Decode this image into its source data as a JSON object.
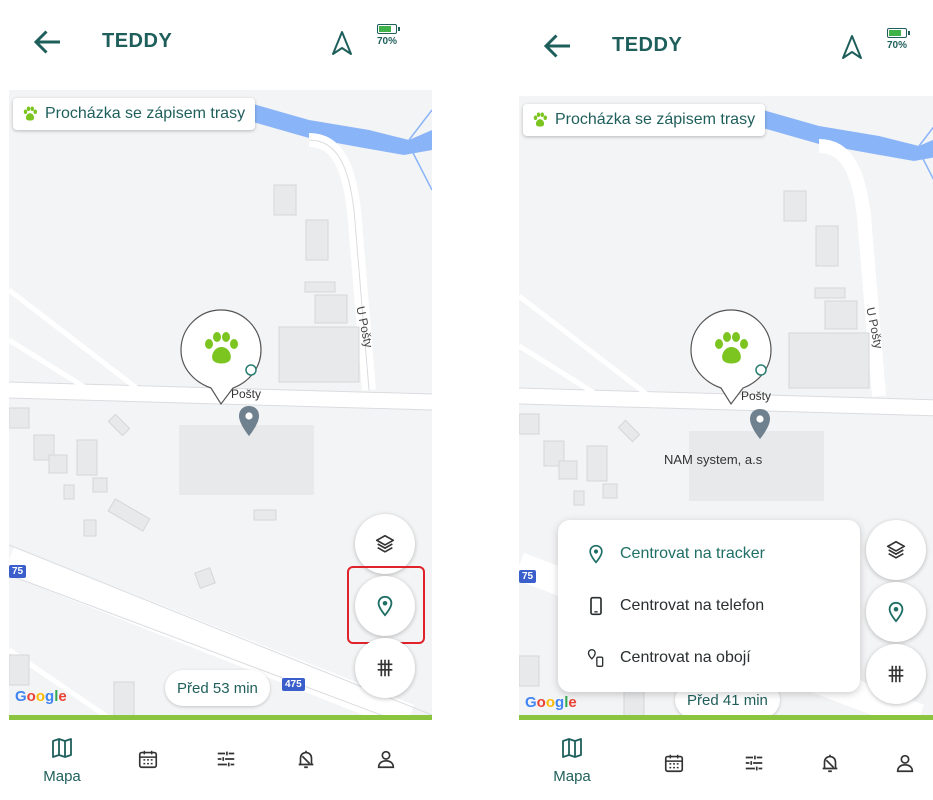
{
  "app": {
    "title": "TEDDY",
    "battery_pct": "70%",
    "battery_level": 0.7
  },
  "map": {
    "route_chip": "Procházka se zápisem trasy",
    "poi_label_left": "Pošty",
    "poi_label_right": "Pošty",
    "street_label": "U Pošty",
    "company_label": "NAM system, a.s",
    "road_number": "475",
    "road_number_edge": "75",
    "time_chip_left": "Před 53 min",
    "time_chip_right": "Před 41 min",
    "google": [
      "G",
      "o",
      "o",
      "g",
      "l",
      "e"
    ]
  },
  "center_menu": {
    "items": [
      {
        "label": "Centrovat na tracker",
        "icon": "location-pin-icon"
      },
      {
        "label": "Centrovat na telefon",
        "icon": "phone-icon"
      },
      {
        "label": "Centrovat na obojí",
        "icon": "pin-phone-icon"
      }
    ]
  },
  "bottom_nav": {
    "items": [
      {
        "label": "Mapa",
        "icon": "map-icon"
      },
      {
        "label": "",
        "icon": "calendar-icon"
      },
      {
        "label": "",
        "icon": "sliders-icon"
      },
      {
        "label": "",
        "icon": "alarm-icon"
      },
      {
        "label": "",
        "icon": "user-icon"
      }
    ]
  },
  "colors": {
    "primary": "#1f5f5b",
    "accent_green": "#8bc43f",
    "paw_green": "#7cc521",
    "highlight_red": "#e0232b",
    "river_blue": "#8ab4f8"
  }
}
